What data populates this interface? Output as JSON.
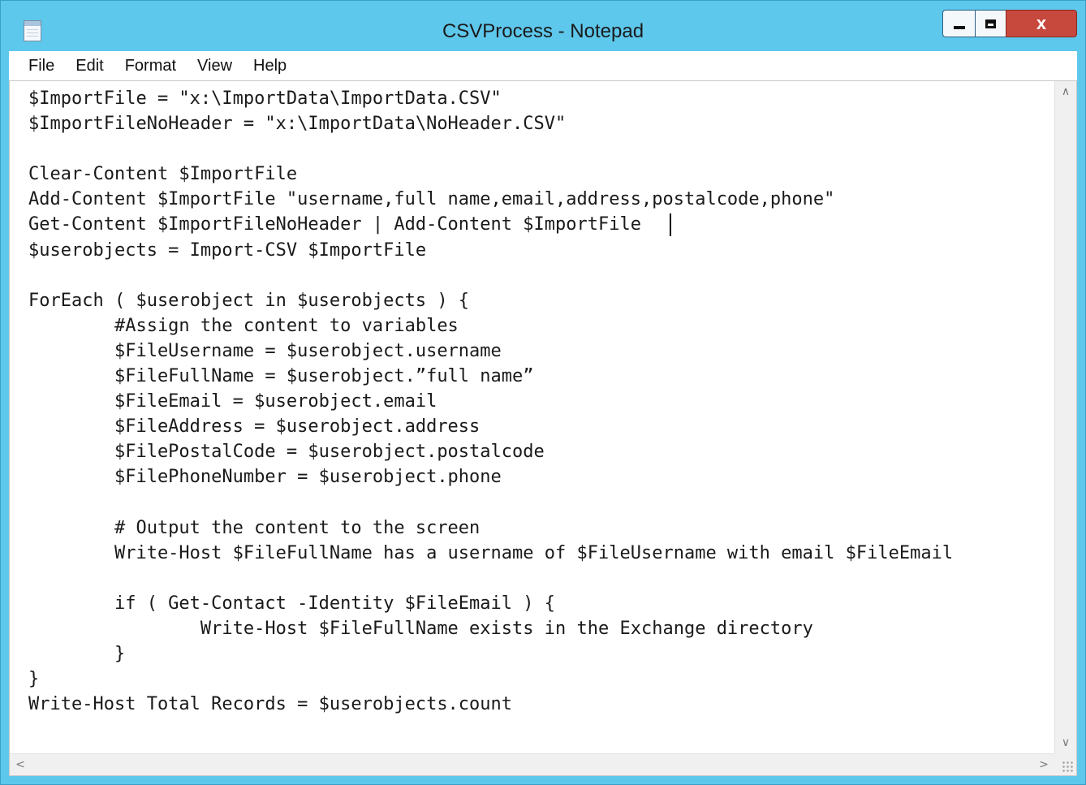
{
  "window": {
    "title": "CSVProcess - Notepad",
    "close_glyph": "x",
    "icon": "notepad-icon"
  },
  "menu": {
    "items": [
      "File",
      "Edit",
      "Format",
      "View",
      "Help"
    ]
  },
  "editor": {
    "lines": [
      "$ImportFile = \"x:\\ImportData\\ImportData.CSV\"",
      "$ImportFileNoHeader = \"x:\\ImportData\\NoHeader.CSV\"",
      "",
      "Clear-Content $ImportFile",
      "Add-Content $ImportFile \"username,full name,email,address,postalcode,phone\"",
      "Get-Content $ImportFileNoHeader | Add-Content $ImportFile",
      "$userobjects = Import-CSV $ImportFile",
      "",
      "ForEach ( $userobject in $userobjects ) {",
      "        #Assign the content to variables",
      "        $FileUsername = $userobject.username",
      "        $FileFullName = $userobject.”full name”",
      "        $FileEmail = $userobject.email",
      "        $FileAddress = $userobject.address",
      "        $FilePostalCode = $userobject.postalcode",
      "        $FilePhoneNumber = $userobject.phone",
      "",
      "        # Output the content to the screen",
      "        Write-Host $FileFullName has a username of $FileUsername with email $FileEmail",
      "",
      "        if ( Get-Contact -Identity $FileEmail ) {",
      "                Write-Host $FileFullName exists in the Exchange directory",
      "        }",
      "}",
      "Write-Host Total Records = $userobjects.count"
    ]
  },
  "scrollbars": {
    "up": "∧",
    "down": "∨",
    "left": "<",
    "right": ">"
  }
}
